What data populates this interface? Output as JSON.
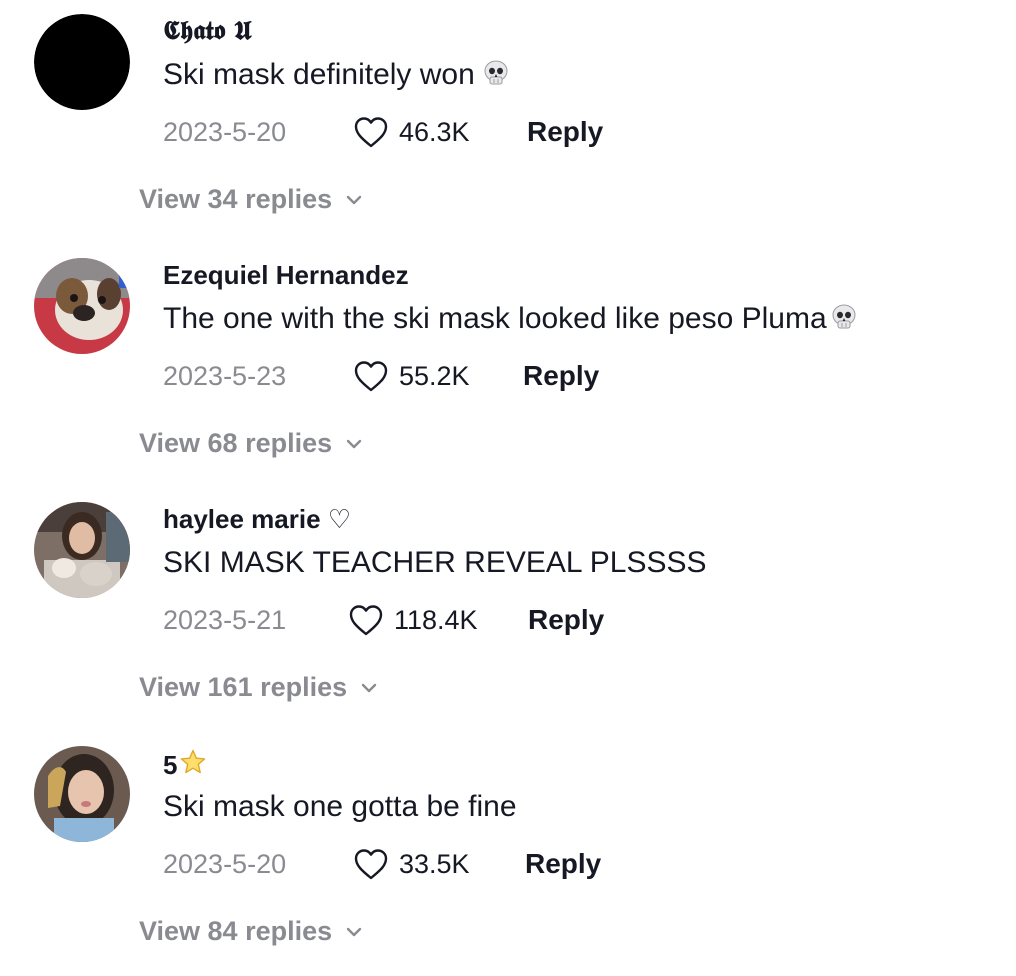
{
  "comments": [
    {
      "username": "𝕮𝖍𝖆𝖙𝖔 𝖀",
      "text": "Ski mask definitely won",
      "emoji": "skull-emoji",
      "date": "2023-5-20",
      "likes": "46.3K",
      "reply_label": "Reply",
      "view_replies": "View 34 replies",
      "avatar": "black-circle-avatar"
    },
    {
      "username": "Ezequiel Hernandez",
      "text": "The one with the ski mask looked like peso Pluma",
      "emoji": "skull-emoji",
      "date": "2023-5-23",
      "likes": "55.2K",
      "reply_label": "Reply",
      "view_replies": "View 68 replies",
      "avatar": "dog-photo-avatar"
    },
    {
      "username": "haylee marie ♡",
      "text": "SKI MASK TEACHER REVEAL PLSSSS",
      "date": "2023-5-21",
      "likes": "118.4K",
      "reply_label": "Reply",
      "view_replies": "View 161 replies",
      "avatar": "girl-photo-avatar"
    },
    {
      "username": "5",
      "username_emoji": "star-emoji",
      "text": "Ski mask one gotta be fine",
      "date": "2023-5-20",
      "likes": "33.5K",
      "reply_label": "Reply",
      "view_replies": "View 84 replies",
      "avatar": "selfie-photo-avatar"
    }
  ],
  "colors": {
    "primary_text": "#161823",
    "secondary_text": "#8a8b91",
    "background": "#ffffff"
  }
}
